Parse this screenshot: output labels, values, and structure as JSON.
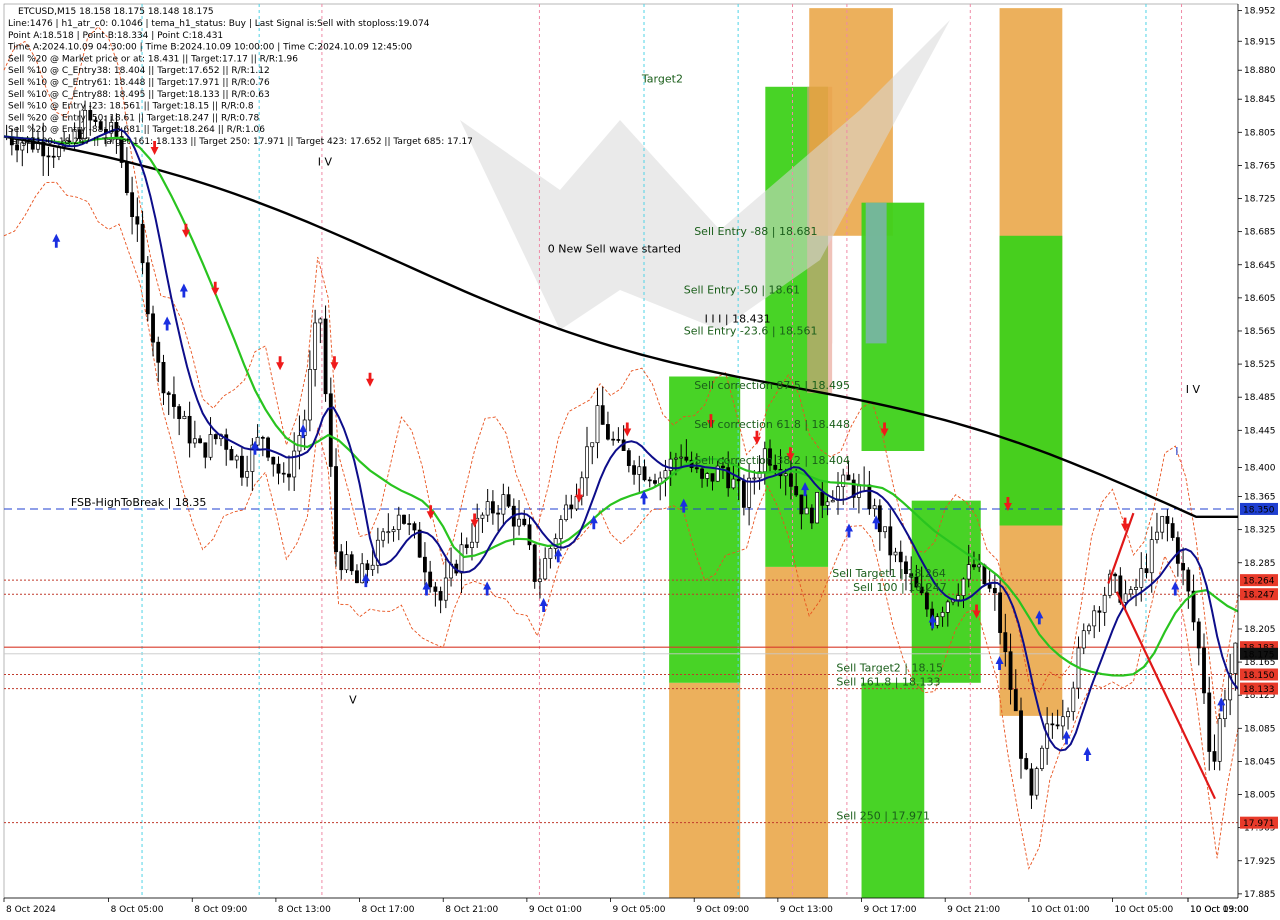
{
  "window": {
    "symbol_line": "ETCUSD,M15  18.158 18.175 18.148 18.175"
  },
  "info_lines": [
    "Line:1476  |  h1_atr_c0: 0.1046  |  tema_h1_status: Buy  |  Last Signal is:Sell with stoploss:19.074",
    "Point A:18.518  |  Point B:18.334  |  Point C:18.431",
    "Time A:2024.10.09 04:30:00  |  Time B:2024.10.09 10:00:00  |  Time C:2024.10.09 12:45:00",
    "Sell %20 @ Market price or at: 18.431  ||  Target:17.17  ||  R/R:1.96",
    "Sell %10 @ C_Entry38: 18.404  ||  Target:17.652  ||  R/R:1.12",
    "Sell %10 @ C_Entry61: 18.448  ||  Target:17.971  ||  R/R:0.76",
    "Sell %10 @ C_Entry88: 18.495  ||  Target:18.133  ||  R/R:0.63",
    "Sell %10 @ Entry -23: 18.561  ||  Target:18.15  ||  R/R:0.8",
    "Sell %20 @ Entry -50: 18.61  ||  Target:18.247  ||  R/R:0.78",
    "Sell %20 @ Entry -88: 18.681  ||  Target:18.264  ||  R/R:1.06",
    "Target100: 18.247  ||  Target 161: 18.133  ||  Target 250: 17.971  ||  Target 423: 17.652  ||  Target 685: 17.17"
  ],
  "chart_data": {
    "type": "candlestick",
    "title": "ETCUSD,M15",
    "ylim": [
      17.88,
      18.96
    ],
    "x_ticks": [
      "8 Oct 2024",
      "8 Oct 05:00",
      "8 Oct 09:00",
      "8 Oct 13:00",
      "8 Oct 17:00",
      "8 Oct 21:00",
      "9 Oct 01:00",
      "9 Oct 05:00",
      "9 Oct 09:00",
      "9 Oct 13:00",
      "9 Oct 17:00",
      "9 Oct 21:00",
      "10 Oct 01:00",
      "10 Oct 05:00",
      "10 Oct 09:00",
      "10 Oct 13:00"
    ],
    "y_ticks": [
      "18.952",
      "18.915",
      "18.880",
      "18.845",
      "18.805",
      "18.765",
      "18.725",
      "18.685",
      "18.645",
      "18.605",
      "18.565",
      "18.525",
      "18.485",
      "18.445",
      "18.400",
      "18.365",
      "18.325",
      "18.285",
      "18.245",
      "18.205",
      "18.165",
      "18.125",
      "18.085",
      "18.045",
      "18.005",
      "17.965",
      "17.925",
      "17.885"
    ],
    "price_tags": [
      {
        "value": "18.350",
        "color": "#1f3fd1"
      },
      {
        "value": "18.264",
        "color": "#e83a2a"
      },
      {
        "value": "18.247",
        "color": "#e83a2a"
      },
      {
        "value": "18.183",
        "color": "#e83a2a"
      },
      {
        "value": "18.175",
        "color": "#111111"
      },
      {
        "value": "18.150",
        "color": "#e83a2a"
      },
      {
        "value": "18.133",
        "color": "#e83a2a"
      },
      {
        "value": "17.971",
        "color": "#e83a2a"
      }
    ],
    "levels": [
      {
        "price": 18.35,
        "label": "FSB-HighToBreak  |  18.35",
        "color": "#1f3fd1",
        "style": "dash"
      },
      {
        "price": 18.264,
        "label": "Sell Target1 | 18.264",
        "color": "#c0392b",
        "style": "dot"
      },
      {
        "price": 18.247,
        "label": "Sell 100 | 18.247",
        "color": "#c0392b",
        "style": "dot"
      },
      {
        "price": 18.183,
        "label": "",
        "color": "#d93a2a",
        "style": "solid"
      },
      {
        "price": 18.15,
        "label": "Sell Target2 | 18.15",
        "color": "#c0392b",
        "style": "dot"
      },
      {
        "price": 18.133,
        "label": "Sell 161.8 | 18.133",
        "color": "#c0392b",
        "style": "dot"
      },
      {
        "price": 17.971,
        "label": "Sell  250 | 17.971",
        "color": "#c0392b",
        "style": "dot"
      }
    ],
    "annotations": [
      {
        "text": "0 New Sell wave started",
        "price": 18.66,
        "time": "9 Oct 02:00",
        "color": "#000000"
      },
      {
        "text": "Sell Entry -88 | 18.681",
        "price": 18.681,
        "time": "9 Oct 09:00",
        "color": "#1a5e1a"
      },
      {
        "text": "Sell Entry -50 | 18.61",
        "price": 18.61,
        "time": "9 Oct 08:30",
        "color": "#1a5e1a"
      },
      {
        "text": "I I I | 18.431",
        "price": 18.575,
        "time": "9 Oct 09:30",
        "color": "#000000"
      },
      {
        "text": "Sell Entry -23.6 | 18.561",
        "price": 18.561,
        "time": "9 Oct 08:30",
        "color": "#1a5e1a"
      },
      {
        "text": "Sell correction 87.5 | 18.495",
        "price": 18.495,
        "time": "9 Oct 09:00",
        "color": "#1a5e1a"
      },
      {
        "text": "Sell correction 61.8 | 18.448",
        "price": 18.448,
        "time": "9 Oct 09:00",
        "color": "#1a5e1a"
      },
      {
        "text": "Sell correction 38.2 | 18.404",
        "price": 18.404,
        "time": "9 Oct 09:00",
        "color": "#1a5e1a"
      },
      {
        "text": "Target2",
        "price": 18.865,
        "time": "9 Oct 06:30",
        "color": "#1a5e1a"
      },
      {
        "text": "I V",
        "price": 18.765,
        "time": "8 Oct 15:00",
        "color": "#000000"
      },
      {
        "text": "I V",
        "price": 18.49,
        "time": "10 Oct 08:30",
        "color": "#000000"
      },
      {
        "text": "I",
        "price": 18.415,
        "time": "10 Oct 08:00",
        "color": "#1f3fd1"
      },
      {
        "text": "V",
        "price": 18.115,
        "time": "8 Oct 16:30",
        "color": "#000000"
      }
    ]
  },
  "colors": {
    "sma_black": "#000000",
    "tema_blue": "#0d0d8a",
    "ma_green": "#29c41f",
    "envelope_red": "#e8531f",
    "zone_green": "#3ed11a",
    "zone_orange": "#e9a23f",
    "level_red": "#c0392b"
  }
}
